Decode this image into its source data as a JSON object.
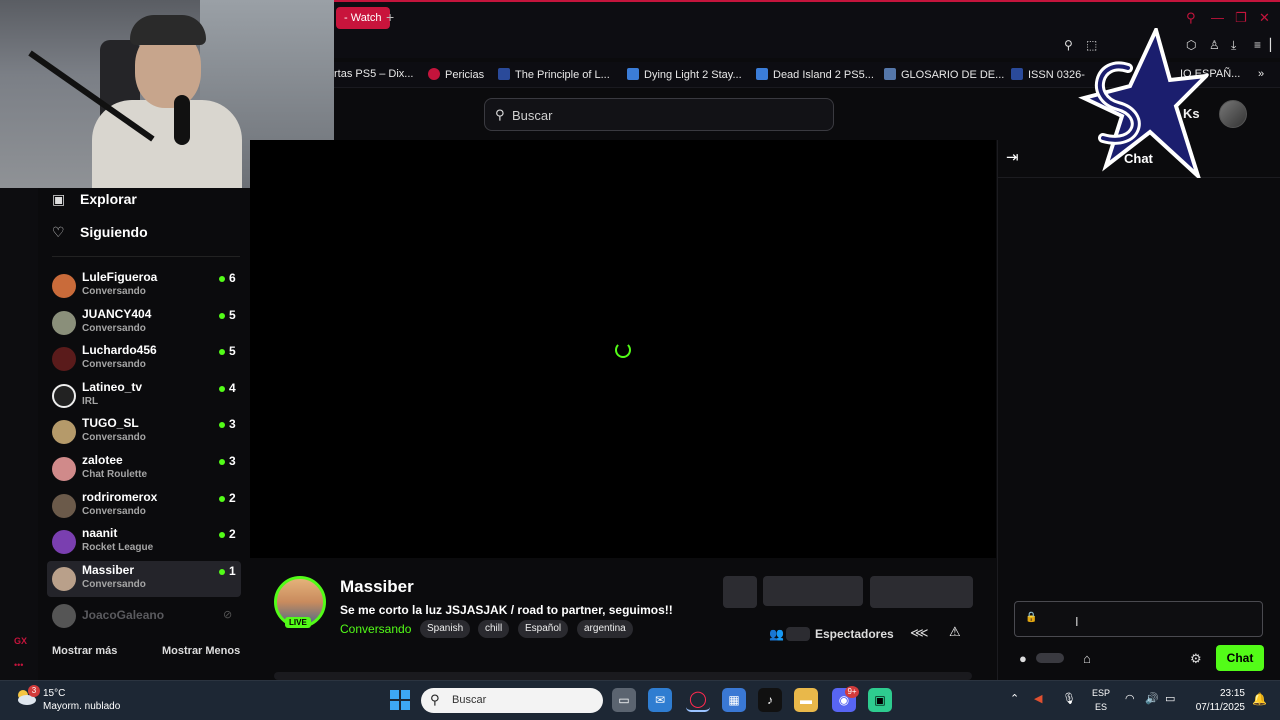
{
  "browser": {
    "active_tab_label": "- Watch",
    "new_tab_symbol": "+",
    "bookmarks": [
      {
        "label": "rtas PS5 – Dix...",
        "color": "#333"
      },
      {
        "label": "Pericias",
        "color": "#c4143c"
      },
      {
        "label": "The Principle of L...",
        "color": "#2a4a9a"
      },
      {
        "label": "Dying Light 2 Stay...",
        "color": "#3b7dd8"
      },
      {
        "label": "Dead Island 2 PS5...",
        "color": "#3b7dd8"
      },
      {
        "label": "GLOSARIO DE DE...",
        "color": "#5577aa"
      },
      {
        "label": "ISSN 0326-",
        "color": "#2a4a9a"
      },
      {
        "label": "IO ESPAÑ...",
        "color": "#333"
      }
    ]
  },
  "site": {
    "search_placeholder": "Buscar",
    "account_label": "Ks"
  },
  "sidebar": {
    "nav": [
      {
        "label": "Explorar",
        "icon": "browse-icon"
      },
      {
        "label": "Siguiendo",
        "icon": "heart-icon"
      }
    ],
    "channels": [
      {
        "name": "LuleFigueroa",
        "category": "Conversando",
        "viewers": "6",
        "color": "#c96b3a"
      },
      {
        "name": "JUANCY404",
        "category": "Conversando",
        "viewers": "5",
        "color": "#8a8f7a"
      },
      {
        "name": "Luchardo456",
        "category": "Conversando",
        "viewers": "5",
        "color": "#5a1b1b"
      },
      {
        "name": "Latineo_tv",
        "category": "IRL",
        "viewers": "4",
        "color": "#222222"
      },
      {
        "name": "TUGO_SL",
        "category": "Conversando",
        "viewers": "3",
        "color": "#b59a6a"
      },
      {
        "name": "zalotee",
        "category": "Chat Roulette",
        "viewers": "3",
        "color": "#d08a8a"
      },
      {
        "name": "rodriromerox",
        "category": "Conversando",
        "viewers": "2",
        "color": "#6b5a4a"
      },
      {
        "name": "naanit",
        "category": "Rocket League",
        "viewers": "2",
        "color": "#7a3fb0"
      },
      {
        "name": "Massiber",
        "category": "Conversando",
        "viewers": "1",
        "color": "#b9a08a"
      }
    ],
    "offline_channel": {
      "name": "JoacoGaleano",
      "color": "#555555"
    },
    "show_more": "Mostrar más",
    "show_less": "Mostrar Menos",
    "gx_label": "GX",
    "gx_dots": "•••"
  },
  "stream": {
    "streamer": "Massiber",
    "live_badge": "LIVE",
    "title": "Se me corto la luz JSJASJAK / road to partner, seguimos!!",
    "category": "Conversando",
    "tags": [
      "Spanish",
      "chill",
      "Español",
      "argentina"
    ],
    "viewers_label": "Espectadores"
  },
  "chat": {
    "title": "Chat",
    "send_label": "Chat"
  },
  "taskbar": {
    "weather_temp": "15°C",
    "weather_desc": "Mayorm. nublado",
    "weather_badge": "3",
    "search_placeholder": "Buscar",
    "lang_top": "ESP",
    "lang_bottom": "ES",
    "time": "23:15",
    "date": "07/11/2025",
    "discord_badge": "9+"
  },
  "colors": {
    "accent": "#53fc18",
    "browser_accent": "#c4143c"
  }
}
